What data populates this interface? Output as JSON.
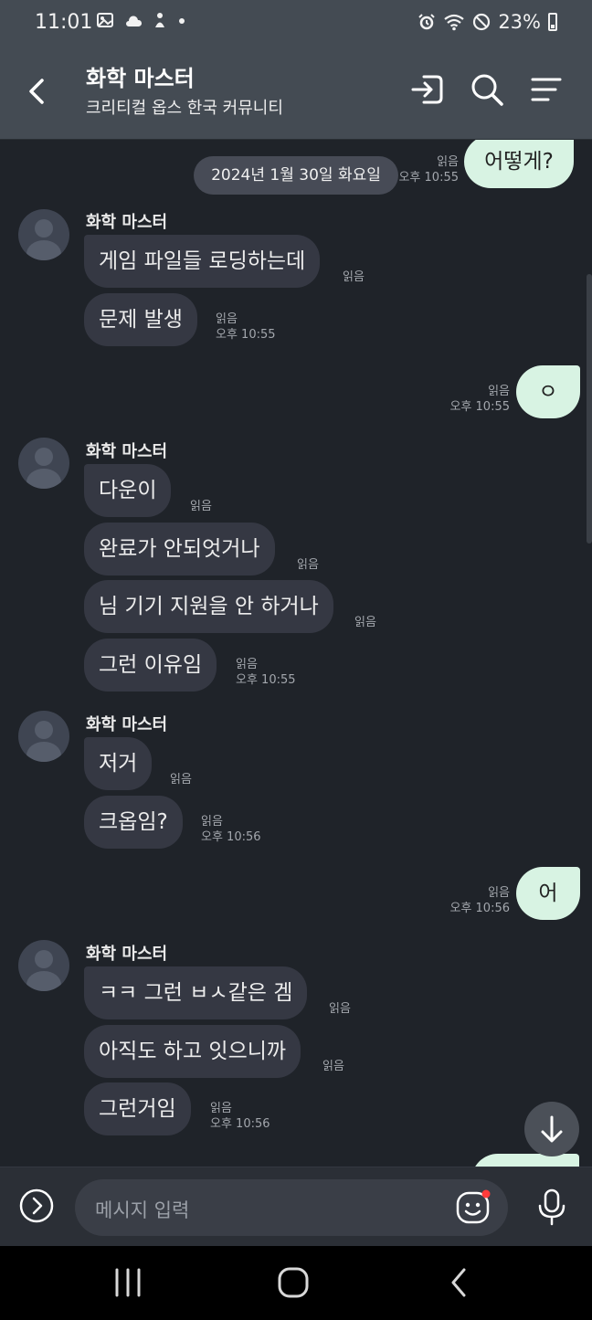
{
  "status": {
    "time": "11:01",
    "battery": "23%"
  },
  "header": {
    "title": "화학 마스터",
    "subtitle": "크리티컬 옵스 한국 커뮤니티"
  },
  "date_divider": "2024년 1월 30일 화요일",
  "messages": [
    {
      "dir": "out",
      "text": "어떻게?",
      "read": "읽음",
      "time": "오후 10:55"
    },
    {
      "dir": "in",
      "sender": "화학 마스터",
      "text": "게임 파일들 로딩하는데",
      "read": "읽음"
    },
    {
      "dir": "in",
      "text": "문제 발생",
      "read": "읽음",
      "time": "오후 10:55"
    },
    {
      "dir": "out",
      "text": "ㅇ",
      "read": "읽음",
      "time": "오후 10:55"
    },
    {
      "dir": "in",
      "sender": "화학 마스터",
      "text": "다운이",
      "read": "읽음"
    },
    {
      "dir": "in",
      "text": "완료가 안되엇거나",
      "read": "읽음"
    },
    {
      "dir": "in",
      "text": "님 기기 지원을 안 하거나",
      "read": "읽음"
    },
    {
      "dir": "in",
      "text": "그런 이유임",
      "read": "읽음",
      "time": "오후 10:55"
    },
    {
      "dir": "in",
      "sender": "화학 마스터",
      "text": "저거",
      "read": "읽음"
    },
    {
      "dir": "in",
      "text": "크옵임?",
      "read": "읽음",
      "time": "오후 10:56"
    },
    {
      "dir": "out",
      "text": "어",
      "read": "읽음",
      "time": "오후 10:56"
    },
    {
      "dir": "in",
      "sender": "화학 마스터",
      "text": "ㅋㅋ 그런 ㅂㅅ같은 겜",
      "read": "읽음"
    },
    {
      "dir": "in",
      "text": "아직도 하고 잇으니까",
      "read": "읽음"
    },
    {
      "dir": "in",
      "text": "그런거임",
      "read": "읽음",
      "time": "오후 10:56"
    }
  ],
  "input": {
    "placeholder": "메시지 입력"
  },
  "icons": {
    "back": "back-arrow-icon",
    "enter": "enter-icon",
    "search": "search-icon",
    "menu": "menu-icon",
    "plus": "expand-chevron-icon",
    "emoji": "emoji-icon",
    "mic": "microphone-icon",
    "scroll": "arrow-down-icon"
  },
  "colors": {
    "header_bg": "#444b53",
    "chat_bg": "#1f2329",
    "incoming_bubble": "#353843",
    "outgoing_bubble": "#d8f3e3",
    "notification_dot": "#ff3b3b"
  }
}
